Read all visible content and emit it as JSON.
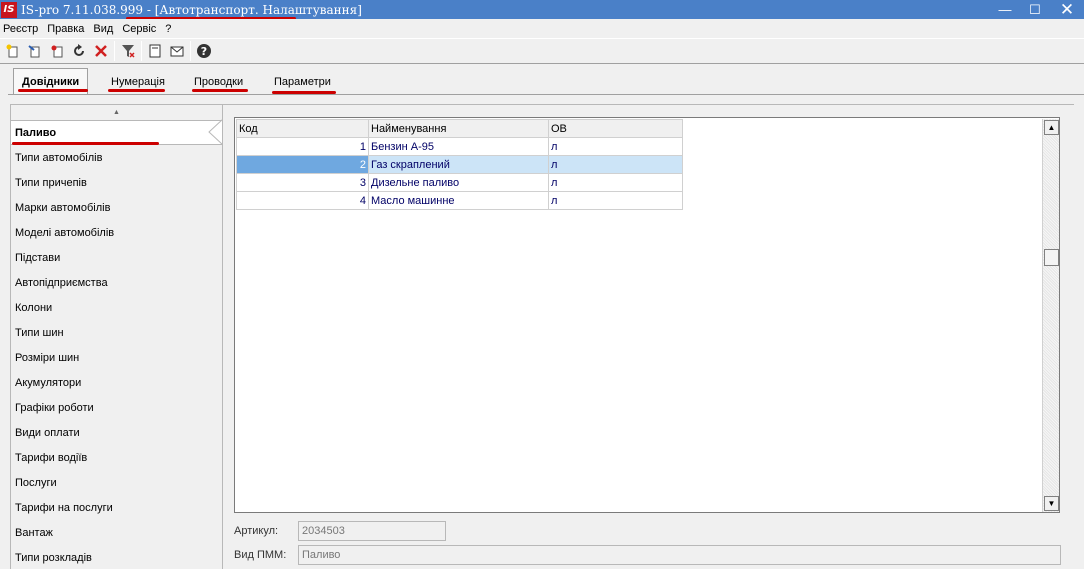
{
  "window": {
    "logo": "IS",
    "title": "IS-pro 7.11.038.999 - [Автотранспорт. Налаштування]",
    "minimize_icon": "minimize-icon",
    "maximize_icon": "maximize-icon",
    "close_icon": "close-icon"
  },
  "menu": [
    "Реєстр",
    "Правка",
    "Вид",
    "Сервіс",
    "?"
  ],
  "tabs": [
    "Довідники",
    "Нумерація",
    "Проводки",
    "Параметри"
  ],
  "active_tab": "Довідники",
  "nav": {
    "items": [
      "Паливо",
      "Типи автомобілів",
      "Типи причепів",
      "Марки автомобілів",
      "Моделі автомобілів",
      "Підстави",
      "Автопідприємства",
      "Колони",
      "Типи шин",
      "Розміри шин",
      "Акумулятори",
      "Графіки роботи",
      "Види оплати",
      "Тарифи водіїв",
      "Послуги",
      "Тарифи на послуги",
      "Вантаж",
      "Типи розкладів"
    ],
    "selected": "Паливо"
  },
  "grid": {
    "columns": [
      "Код",
      "Найменування",
      "ОВ"
    ],
    "rows": [
      {
        "code": "1",
        "name": "Бензин А-95",
        "unit": "л"
      },
      {
        "code": "2",
        "name": "Газ скраплений",
        "unit": "л"
      },
      {
        "code": "3",
        "name": "Дизельне паливо",
        "unit": "л"
      },
      {
        "code": "4",
        "name": "Масло машинне",
        "unit": "л"
      }
    ],
    "selected_row": 2
  },
  "fields": {
    "article_label": "Артикул:",
    "article_value": "2034503",
    "pmm_label": "Вид ПММ:",
    "pmm_value": "Паливо"
  },
  "colors": {
    "titlebar": "#4a80c8",
    "accent_annotation": "#cc0000",
    "selected_row": "#cce4f7"
  }
}
